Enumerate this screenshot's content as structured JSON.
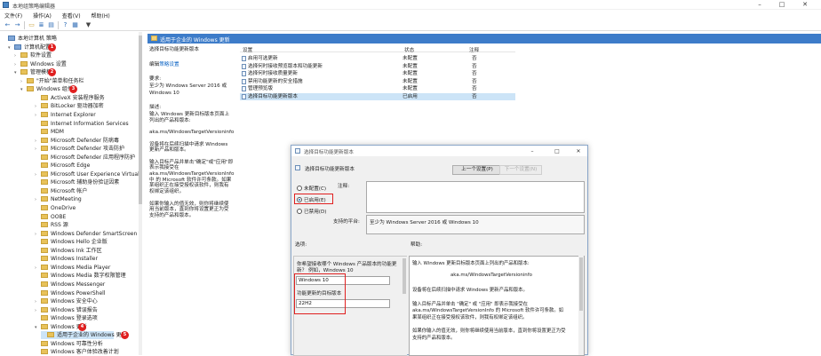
{
  "window": {
    "title": "本地组策略编辑器",
    "controls": [
      "–",
      "□",
      "✕"
    ]
  },
  "menu": [
    "文件(F)",
    "操作(A)",
    "查看(V)",
    "帮助(H)"
  ],
  "toolbar": {
    "icons": [
      "back-icon",
      "forward-icon",
      "folder-icon",
      "list-icon",
      "properties-icon",
      "help-icon",
      "view-icon",
      "filter-icon"
    ]
  },
  "tree": {
    "nodes": [
      {
        "label": "本地计算机 策略",
        "expander": "",
        "kind": "computer"
      },
      {
        "label": "计算机配置",
        "expander": "▾",
        "kind": "computer",
        "badge": "1"
      },
      {
        "label": "软件设置",
        "expander": "›",
        "kind": "folder"
      },
      {
        "label": "Windows 设置",
        "expander": "›",
        "kind": "folder"
      },
      {
        "label": "管理模板",
        "expander": "▾",
        "kind": "folder",
        "badge": "2"
      },
      {
        "label": "\"开始\"菜单和任务栏",
        "expander": "›",
        "kind": "folder"
      },
      {
        "label": "Windows 组件",
        "expander": "▾",
        "kind": "folder",
        "badge": "3"
      },
      {
        "label": "ActiveX 安装程序服务",
        "expander": "",
        "kind": "folder"
      },
      {
        "label": "BitLocker 驱动器加密",
        "expander": "›",
        "kind": "folder"
      },
      {
        "label": "Internet Explorer",
        "expander": "›",
        "kind": "folder"
      },
      {
        "label": "Internet Information Services",
        "expander": "",
        "kind": "folder"
      },
      {
        "label": "MDM",
        "expander": "",
        "kind": "folder"
      },
      {
        "label": "Microsoft Defender 防病毒",
        "expander": "›",
        "kind": "folder"
      },
      {
        "label": "Microsoft Defender 攻击防护",
        "expander": "›",
        "kind": "folder"
      },
      {
        "label": "Microsoft Defender 应用程序防护",
        "expander": "",
        "kind": "folder"
      },
      {
        "label": "Microsoft Edge",
        "expander": "",
        "kind": "folder"
      },
      {
        "label": "Microsoft User Experience Virtualiz",
        "expander": "›",
        "kind": "folder"
      },
      {
        "label": "Microsoft 辅助身份验证因素",
        "expander": "",
        "kind": "folder"
      },
      {
        "label": "Microsoft 帐户",
        "expander": "",
        "kind": "folder"
      },
      {
        "label": "NetMeeting",
        "expander": "›",
        "kind": "folder"
      },
      {
        "label": "OneDrive",
        "expander": "",
        "kind": "folder"
      },
      {
        "label": "OOBE",
        "expander": "",
        "kind": "folder"
      },
      {
        "label": "RSS 源",
        "expander": "",
        "kind": "folder"
      },
      {
        "label": "Windows Defender SmartScreen",
        "expander": "›",
        "kind": "folder"
      },
      {
        "label": "Windows Hello 企业版",
        "expander": "",
        "kind": "folder"
      },
      {
        "label": "Windows Ink 工作区",
        "expander": "",
        "kind": "folder"
      },
      {
        "label": "Windows Installer",
        "expander": "",
        "kind": "folder"
      },
      {
        "label": "Windows Media Player",
        "expander": "›",
        "kind": "folder"
      },
      {
        "label": "Windows Media 数字权限管理",
        "expander": "",
        "kind": "folder"
      },
      {
        "label": "Windows Messenger",
        "expander": "",
        "kind": "folder"
      },
      {
        "label": "Windows PowerShell",
        "expander": "",
        "kind": "folder"
      },
      {
        "label": "Windows 安全中心",
        "expander": "›",
        "kind": "folder"
      },
      {
        "label": "Windows 错误报告",
        "expander": "›",
        "kind": "folder"
      },
      {
        "label": "Windows 登录选项",
        "expander": "",
        "kind": "folder"
      },
      {
        "label": "Windows 更新",
        "expander": "▾",
        "kind": "folder",
        "badge": "4"
      },
      {
        "label": "适用于企业的 Windows 更新",
        "expander": "",
        "kind": "folder",
        "badge": "5",
        "selected": true
      },
      {
        "label": "Windows 可靠性分析",
        "expander": "",
        "kind": "folder"
      },
      {
        "label": "Windows 客户体验改善计划",
        "expander": "",
        "kind": "folder"
      }
    ]
  },
  "right_pane": {
    "header": "适用于企业的 Windows 更新",
    "description": {
      "title": "选择目标功能更新版本",
      "edit_prefix": "编辑",
      "edit_link": "策略设置",
      "req_label": "要求:",
      "req_text": [
        "至少为 Windows Server 2016 或",
        "Windows 10"
      ],
      "desc_label": "描述:",
      "desc_text": [
        "输入 Windows 更新目标版本页面上",
        "列出的产品和版本:",
        "",
        "aka.ms/WindowsTargetVersioninfo",
        "",
        "设备将在后续扫描中请求 Windows",
        "更新产品和版本。",
        "",
        "输入目标产品并单击\"确定\"或\"应用\"即",
        "表示我接受在",
        "aka.ms/WindowsTargetVersionInfo",
        "中 的 Microsoft 软件许可条款。如果",
        "某组织正在接受授权该软件，则我有",
        "权绑定该组织。",
        "",
        "如果你输入的值无效，则你将继续使",
        "用当前版本，直到你将设置更正为受",
        "支持的产品和版本。"
      ]
    },
    "columns": {
      "setting": "设置",
      "state": "状态",
      "comment": "注释"
    },
    "rows": [
      {
        "name": "启用可选更新",
        "state": "未配置",
        "comment": "否"
      },
      {
        "name": "选择何时接收预览版本和功能更新",
        "state": "未配置",
        "comment": "否"
      },
      {
        "name": "选择何时接收质量更新",
        "state": "未配置",
        "comment": "否"
      },
      {
        "name": "禁用功能更新的安全措施",
        "state": "未配置",
        "comment": "否"
      },
      {
        "name": "管理预览版",
        "state": "未配置",
        "comment": "否"
      },
      {
        "name": "选择目标功能更新版本",
        "state": "已启用",
        "comment": "否",
        "selected": true
      }
    ]
  },
  "dialog": {
    "title": "选择目标功能更新版本",
    "controls": [
      "–",
      "□",
      "✕"
    ],
    "policy_name": "选择目标功能更新版本",
    "prev_button": "上一个设置(P)",
    "next_button": "下一个设置(N)",
    "radio": [
      {
        "label": "未配置(C)",
        "checked": false
      },
      {
        "label": "已启用(E)",
        "checked": true
      },
      {
        "label": "已禁用(D)",
        "checked": false
      }
    ],
    "comment_label": "注释:",
    "supported_label": "支持的平台:",
    "supported_value": "至少为 Windows Server 2016 或 Windows 10",
    "options_label": "选项:",
    "help_label": "帮助:",
    "options": {
      "question": [
        "你希望接收哪个 Windows 产品版本的功能更",
        "新？ 例如，Windows 10"
      ],
      "product_value": "Windows 10",
      "target_label": "功能更新的目标版本",
      "target_value": "22H2"
    },
    "help_text": [
      "输入 Windows 更新目标版本页面上列出的产品和版本:",
      "",
      "aka.ms/WindowsTargetVersioninfo",
      "",
      "设备将在后续扫描中请求 Windows 更新产品和版本。",
      "",
      "输入目标产品并单击 \"确定\" 或 \"应用\" 即表示我接受在",
      "aka.ms/WindowsTargetVersionInfo 的 Microsoft 软件许可条款。如",
      "果某组织正在接受授权该软件，则我有权绑定该组织。",
      "",
      "如果你输入的值无效，则你将继续使用当前版本，直到你将设置更正为受",
      "支持的产品和版本。"
    ]
  },
  "colors": {
    "accent": "#3d7cc9",
    "selection": "#cce4f7",
    "annotation": "#e02020"
  }
}
